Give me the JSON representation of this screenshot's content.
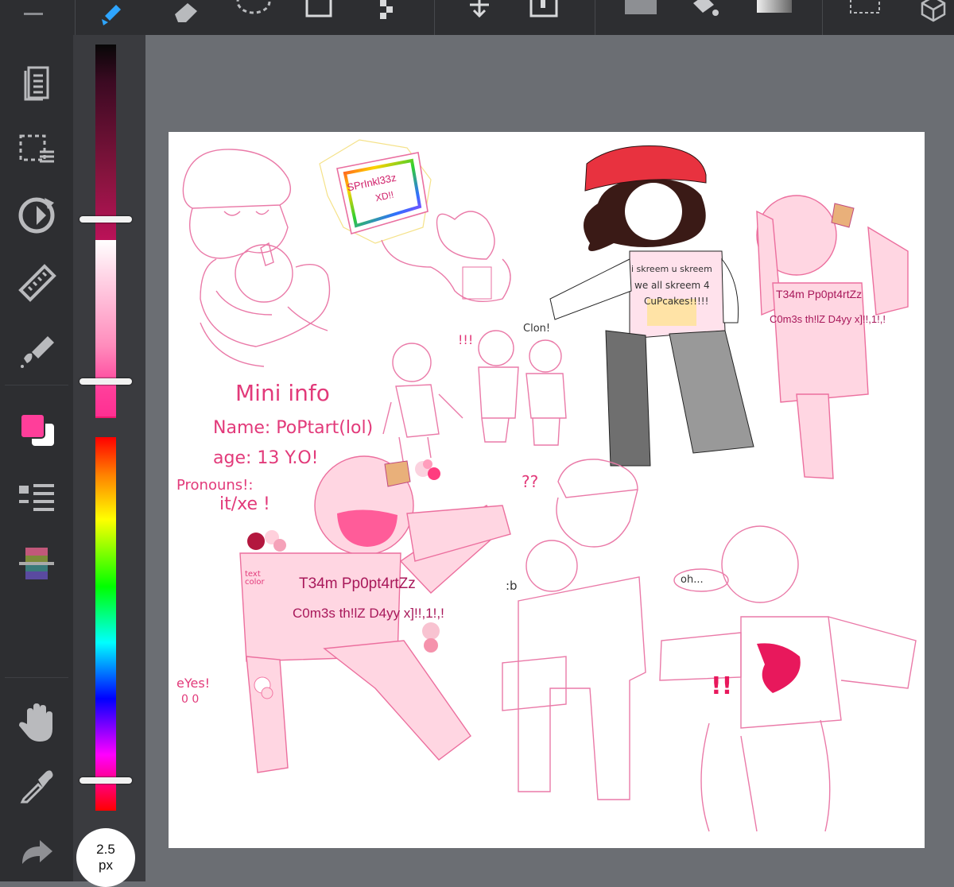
{
  "toolbar": {
    "icons": [
      "menu-icon",
      "brush-icon",
      "eraser-icon",
      "lasso-select-icon",
      "square-select-icon",
      "magic-wand-icon",
      "move-icon",
      "transform-icon",
      "fill-icon",
      "bucket-icon",
      "gradient-icon",
      "deselect-icon",
      "3d-cube-icon"
    ],
    "active_tool_color": "#2ea5ff"
  },
  "sidebar": {
    "icons": [
      "layers-icon",
      "selection-menu-icon",
      "rotate-icon",
      "ruler-icon",
      "filter-icon",
      "color-swatch-icon",
      "layer-list-icon",
      "color-palette-icon",
      "hand-icon",
      "eyedropper-icon",
      "redo-icon"
    ],
    "primary_color": "#ff3e9a",
    "secondary_color": "#ffffff"
  },
  "brush": {
    "size_value": "2.5",
    "size_unit": "px"
  },
  "canvas": {
    "notes": {
      "mini_info_title": "Mini info",
      "name_line": "Name: PoPtart(lol)",
      "age_line": "age: 13 Y.O!",
      "pronouns_label": "Pronouns!:",
      "pronouns_value": "it/xe !",
      "eyes_label": "eYes!",
      "eyes_sample": "0 0",
      "text_color_label": "text color",
      "exclaim_mid": "!!!",
      "exclaim_big": "!!",
      "question_marks": "??",
      "clon_label": "Clon!",
      "oh_bubble": "oh...",
      "b_bubble": ":b"
    },
    "shirt_text": {
      "line1": "T34m Pp0pt4rtZz",
      "line2": "C0m3s th!lZ D4yy x]!!,1!,!"
    },
    "sign_text": {
      "line1": "SPrInkl33z",
      "line2": "XD!!"
    },
    "black_shirt_text": {
      "line1": "i skreem u skreem",
      "line2": "we all skreem 4",
      "line3": "CuPcakes!!!!!"
    }
  }
}
